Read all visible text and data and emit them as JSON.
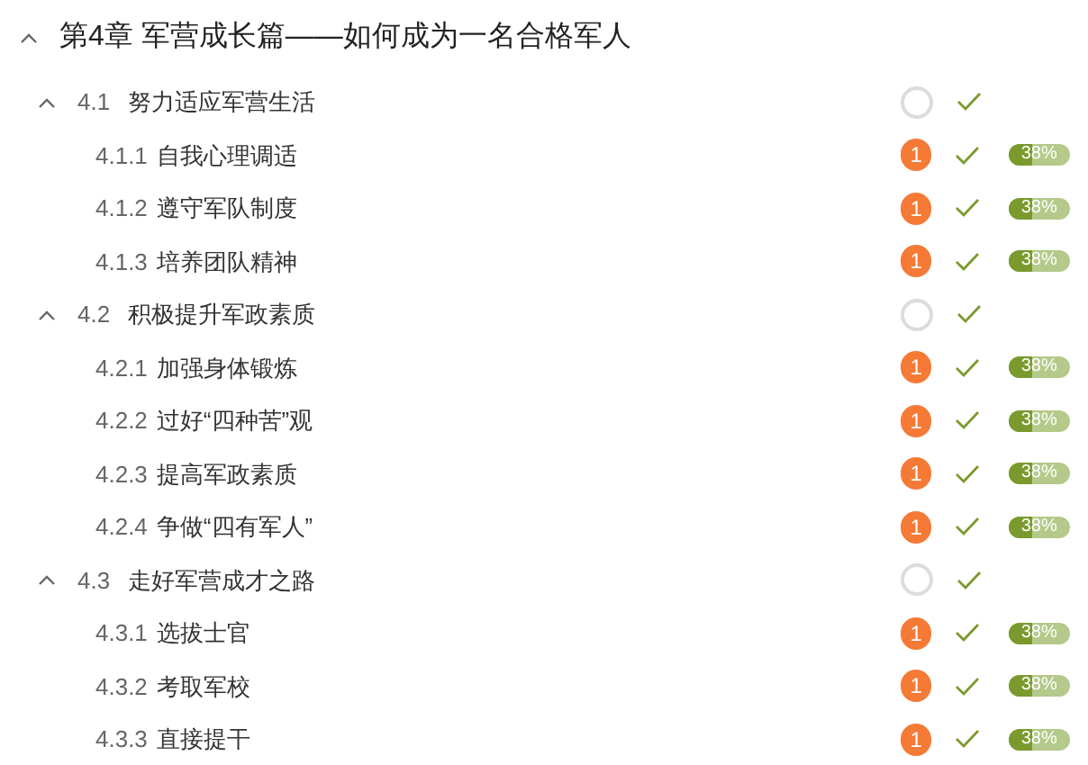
{
  "chapter": {
    "title": "第4章 军营成长篇——如何成为一名合格军人",
    "expanded": true
  },
  "sections": [
    {
      "number": "4.1",
      "title": "努力适应军营生活",
      "expanded": true,
      "done": true,
      "lessons": [
        {
          "number": "4.1.1",
          "title": "自我心理调适",
          "badge": "1",
          "done": true,
          "level": 0.38,
          "reading": "38%"
        },
        {
          "number": "4.1.2",
          "title": "遵守军队制度",
          "badge": "1",
          "done": true,
          "level": 0.38,
          "reading": "38%"
        },
        {
          "number": "4.1.3",
          "title": "培养团队精神",
          "badge": "1",
          "done": true,
          "level": 0.38,
          "reading": "38%"
        }
      ]
    },
    {
      "number": "4.2",
      "title": "积极提升军政素质",
      "expanded": true,
      "done": true,
      "lessons": [
        {
          "number": "4.2.1",
          "title": "加强身体锻炼",
          "badge": "1",
          "done": true,
          "level": 0.38,
          "reading": "38%"
        },
        {
          "number": "4.2.2",
          "title": "过好“四种苦”观",
          "badge": "1",
          "done": true,
          "level": 0.38,
          "reading": "38%"
        },
        {
          "number": "4.2.3",
          "title": "提高军政素质",
          "badge": "1",
          "done": true,
          "level": 0.38,
          "reading": "38%"
        },
        {
          "number": "4.2.4",
          "title": "争做“四有军人”",
          "badge": "1",
          "done": true,
          "level": 0.38,
          "reading": "38%"
        }
      ]
    },
    {
      "number": "4.3",
      "title": "走好军营成才之路",
      "expanded": true,
      "done": true,
      "lessons": [
        {
          "number": "4.3.1",
          "title": "选拔士官",
          "badge": "1",
          "done": true,
          "level": 0.38,
          "reading": "38%"
        },
        {
          "number": "4.3.2",
          "title": "考取军校",
          "badge": "1",
          "done": true,
          "level": 0.38,
          "reading": "38%"
        },
        {
          "number": "4.3.3",
          "title": "直接提干",
          "badge": "1",
          "done": true,
          "level": 0.38,
          "reading": "38%"
        }
      ]
    }
  ]
}
